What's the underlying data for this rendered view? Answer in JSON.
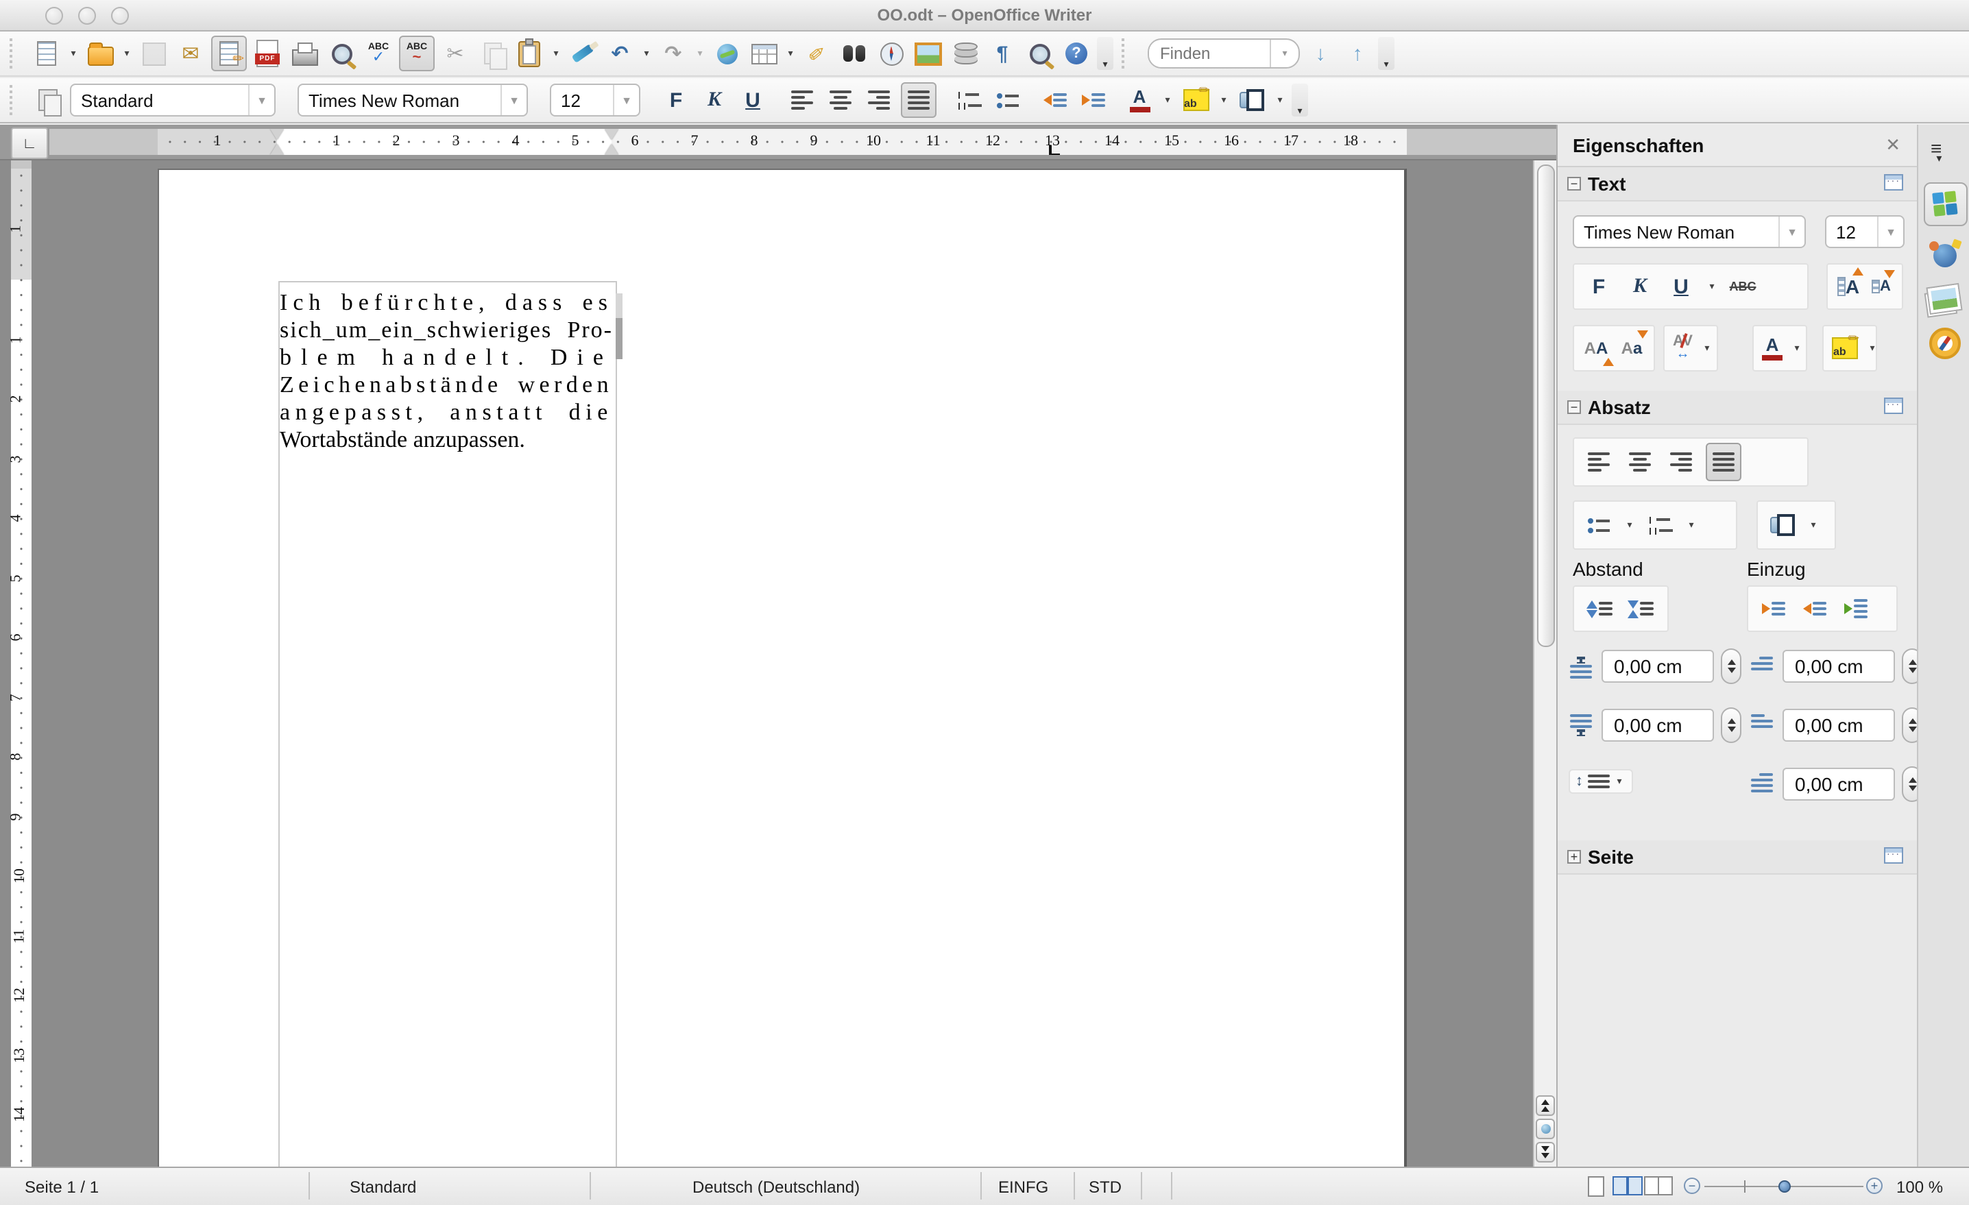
{
  "window": {
    "title": "OO.odt – OpenOffice Writer"
  },
  "toolbars": {
    "find": {
      "placeholder": "Finden"
    },
    "format": {
      "style": "Standard",
      "font": "Times New Roman",
      "size": "12",
      "bold": "F",
      "italic": "K",
      "underline": "U"
    }
  },
  "icons": {
    "abc": "ABC",
    "check": "✓",
    "wave": "~",
    "pdf": "PDF",
    "cut": "✂",
    "mail": "✉",
    "pencil": "✏",
    "undo": "↶",
    "redo": "↷",
    "pilcrow": "¶",
    "help_q": "?",
    "down_arrow": "↓",
    "up_arrow": "↑",
    "hamburger": "≡",
    "linespacing": "↕",
    "collapse": "−",
    "expand": "+",
    "close": "✕"
  },
  "ruler": {
    "h_margin": "1",
    "h_numbers": [
      "1",
      "2",
      "3",
      "4",
      "5",
      "6",
      "7",
      "8",
      "9",
      "10",
      "11",
      "12",
      "13",
      "14",
      "15",
      "16",
      "17",
      "18"
    ],
    "v_margin": "1",
    "v_numbers": [
      "1",
      "2",
      "3",
      "4",
      "5",
      "6",
      "7",
      "8",
      "9",
      "10",
      "11",
      "12",
      "13",
      "14"
    ]
  },
  "document": {
    "lines": [
      "Ich befürchte, dass es",
      "sich_um_ein_schwieriges Pro-",
      "blem handelt. Die",
      "Zeichenabstände werden",
      "angepasst, anstatt die",
      "Wortabstände anzupassen."
    ]
  },
  "sidebar": {
    "title": "Eigenschaften",
    "text_section": {
      "label": "Text",
      "font": "Times New Roman",
      "size": "12",
      "bold": "F",
      "italic": "K",
      "underline": "U",
      "strike": "ABC",
      "grow": "A",
      "shrink": "A",
      "upper": "AA",
      "lower": "Aa",
      "spacing_ab": "AV",
      "color_a": "A",
      "highlight_ab": "ab"
    },
    "absatz_section": {
      "label": "Absatz",
      "abstand": "Abstand",
      "einzug": "Einzug",
      "above": "0,00 cm",
      "below": "0,00 cm",
      "before": "0,00 cm",
      "after": "0,00 cm",
      "firstline": "0,00 cm"
    },
    "seite_section": {
      "label": "Seite"
    }
  },
  "statusbar": {
    "page": "Seite 1 / 1",
    "style": "Standard",
    "language": "Deutsch (Deutschland)",
    "insert_mode": "EINFG",
    "selection_mode": "STD",
    "zoom_level": "100 %"
  }
}
